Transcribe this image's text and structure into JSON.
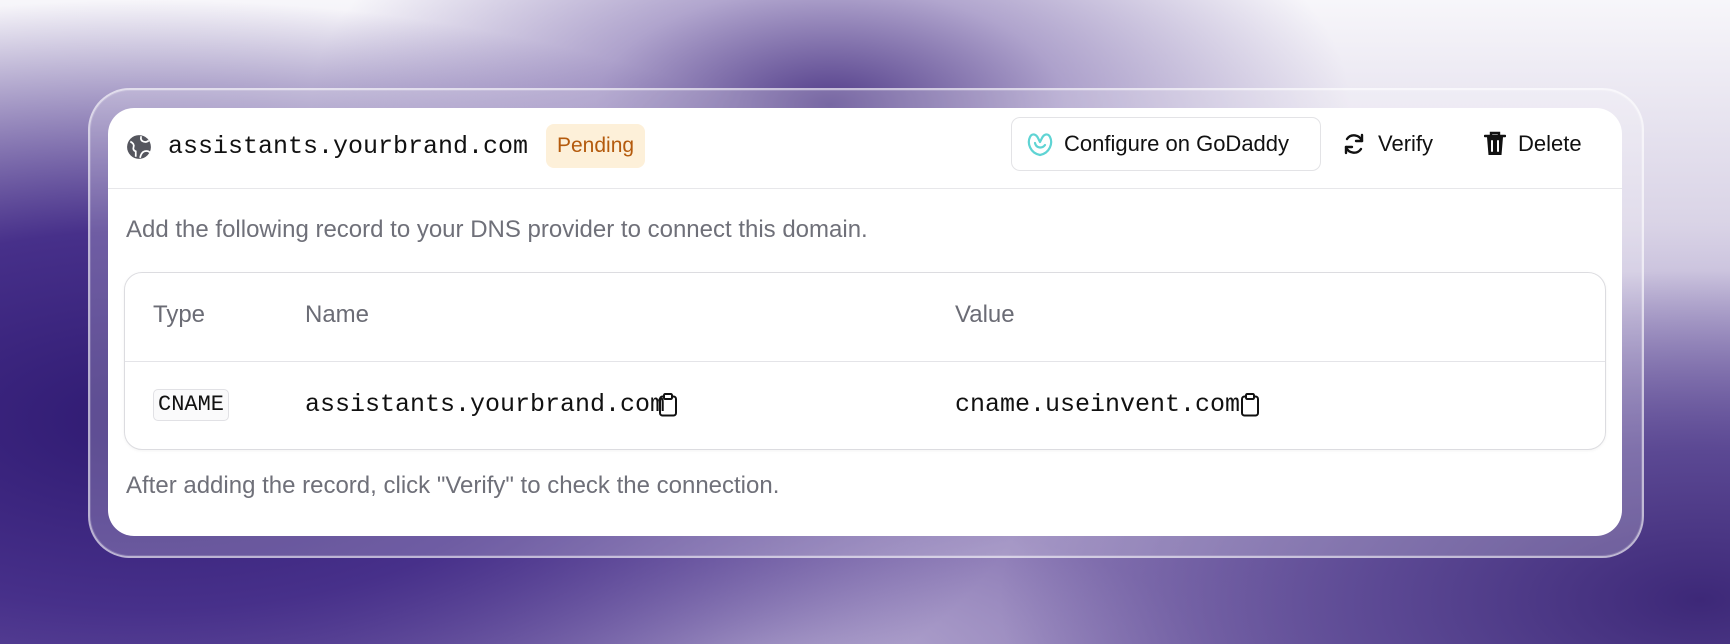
{
  "domain_card": {
    "domain": "assistants.yourbrand.com",
    "status": "Pending",
    "actions": {
      "configure_label": "Configure on GoDaddy",
      "verify_label": "Verify",
      "delete_label": "Delete"
    },
    "instructions": "Add the following record to your DNS provider to connect this domain.",
    "table": {
      "headers": [
        "Type",
        "Name",
        "Value"
      ],
      "rows": [
        {
          "type": "CNAME",
          "name": "assistants.yourbrand.com",
          "value": "cname.useinvent.com"
        }
      ]
    },
    "footer_note": "After adding the record, click \"Verify\" to check the connection."
  },
  "icons": {
    "domain": "globe-icon",
    "configure": "godaddy-logo-icon",
    "verify": "refresh-icon",
    "delete": "trash-icon",
    "copy": "clipboard-icon"
  },
  "colors": {
    "badge_bg": "#fdf0d9",
    "badge_text": "#b45a0c",
    "godaddy_logo": "#5fd4d4"
  }
}
